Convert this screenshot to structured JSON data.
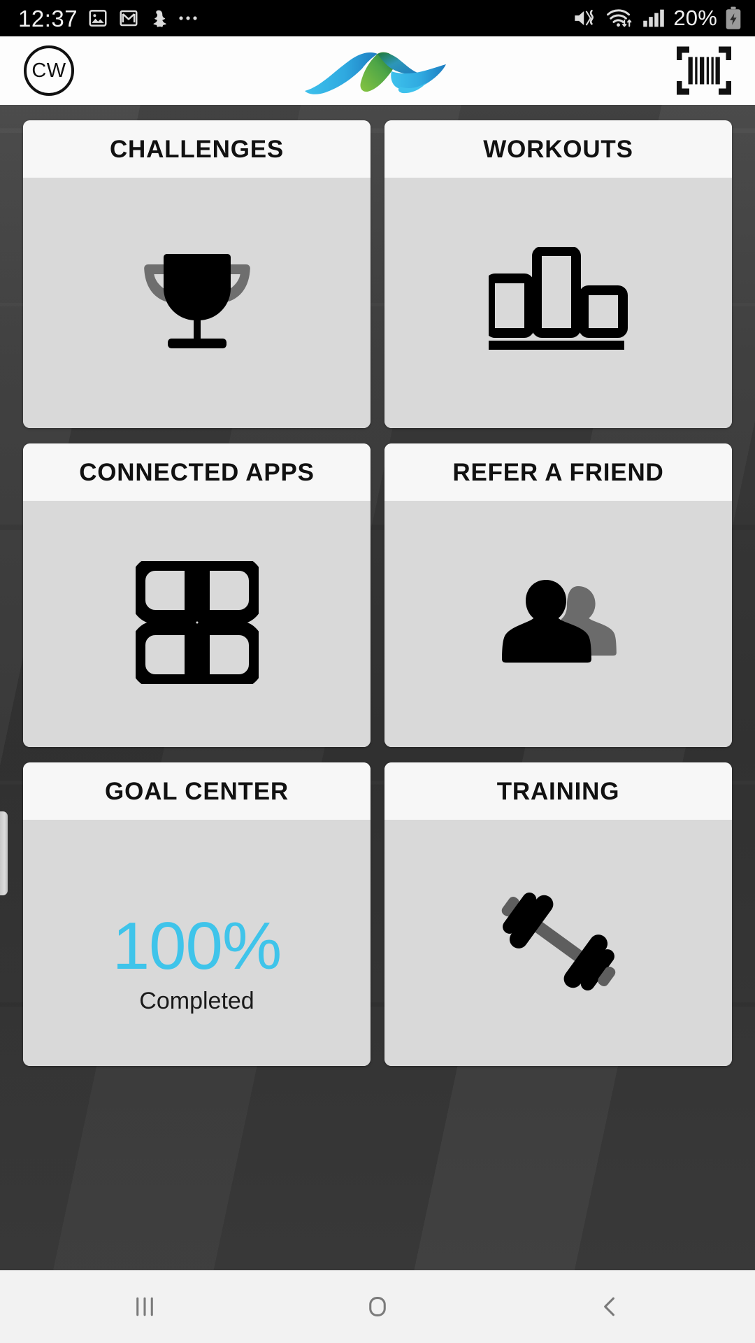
{
  "status_bar": {
    "time": "12:37",
    "battery_text": "20%",
    "icons": [
      {
        "name": "gallery-icon"
      },
      {
        "name": "gmail-icon"
      },
      {
        "name": "snapchat-icon"
      },
      {
        "name": "more-notifications-icon"
      },
      {
        "name": "mute-vibrate-icon"
      },
      {
        "name": "wifi-icon"
      },
      {
        "name": "cellular-signal-icon"
      },
      {
        "name": "battery-charging-icon"
      }
    ]
  },
  "header": {
    "avatar_initials": "CW",
    "logo_name": "brand-wave-logo",
    "logo_colors": {
      "cyan": "#35bdea",
      "blue": "#1f7fc4",
      "green": "#76bc43",
      "dark_green": "#1f7a3a"
    },
    "scan_button_name": "barcode-scan-icon"
  },
  "cards": [
    {
      "id": "challenges",
      "title": "CHALLENGES",
      "icon": "trophy-icon"
    },
    {
      "id": "workouts",
      "title": "WORKOUTS",
      "icon": "bar-chart-icon"
    },
    {
      "id": "connected-apps",
      "title": "CONNECTED APPS",
      "icon": "app-grid-icon"
    },
    {
      "id": "refer-a-friend",
      "title": "REFER A FRIEND",
      "icon": "two-people-icon"
    },
    {
      "id": "goal-center",
      "title": "GOAL CENTER",
      "icon": "progress-text",
      "value": "100%",
      "value_label": "Completed",
      "value_color": "#3fc4ea"
    },
    {
      "id": "training",
      "title": "TRAINING",
      "icon": "dumbbell-icon"
    }
  ],
  "nav_bar": {
    "recents_label": "recent-apps",
    "home_label": "home",
    "back_label": "back"
  },
  "theme": {
    "background": "#3a3a3a",
    "card_body": "#d9d9d9",
    "card_head": "#f7f7f7",
    "accent": "#3fc4ea"
  }
}
